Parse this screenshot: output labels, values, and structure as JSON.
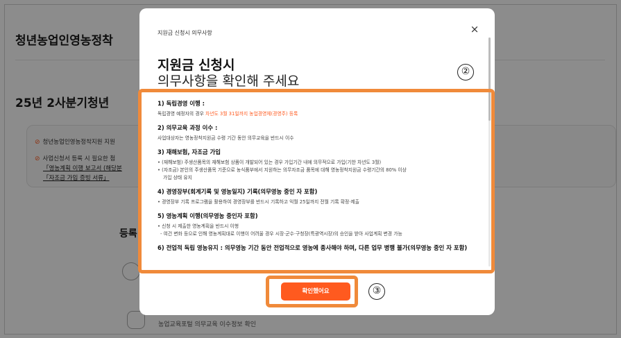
{
  "background": {
    "title": "청년농업인영농정착",
    "subtitle": "25년 2사분기청년",
    "notice_lines": [
      "청년농업인영농정착지원 지원",
      "사업신청서 등록 시 필요한 첨",
      "「영농계획 이행 보고서 (해당분",
      "「자조금 가입 증빙 서류」"
    ],
    "register_title": "등록",
    "row_text": "농업교육포털 의무교육 이수정보 확인"
  },
  "modal": {
    "header_title": "지원금 신청시 의무사항",
    "close_label": "×",
    "headline_line1": "지원금 신청시",
    "headline_line2": "의무사항을 확인해 주세요",
    "sections": [
      {
        "title": "1) 독립경영 이행 :",
        "body_prefix": "독립경영 예정자의 경우 ",
        "body_highlight": "차년도 3월 31일까지 농업경영체(경영주) 등록"
      },
      {
        "title": "2) 의무교육 과정 이수 :",
        "body": "사업대상자는 영농정착지원금 수령 기간 동안 의무교육을 반드시 이수"
      },
      {
        "title": "3) 재해보험, 자조금 가입",
        "bullets": [
          "• (재해보험) 주생산품목의 재해보험 상품이 개발되어 있는 경우 가입기간 내에 의무적으로 가입(기한 차년도 3월)",
          "• (자조금) 본인의 주생산품목 기준으로 농식품부에서 지원하는 의무자조금 품목에 대해 영농정착지원금 수령기간의 80% 이상",
          "가입 상태 유지"
        ]
      },
      {
        "title": "4) 경영장부(회계기록 및 영농일지) 기록(의무영농 중인 자 포함)",
        "bullets": [
          "• 경영장부 기록 프로그램을 활용하여 경영장부를 반드시 기록하고 익월 25일까지 전월 기록 확정·제출"
        ]
      },
      {
        "title": "5) 영농계획 이행(의무영농 중인자 포함)",
        "bullets": [
          "• 신청 시 제출한 영농계획을 반드시 이행",
          "- 여건 변화 등으로 인해 영농계획대로 이행이 어려울 경우 시장·군수·구청장(특광역시장)의 승인을 받아 사업계획 변경 가능"
        ]
      },
      {
        "title": "6) 전업적 독립 영농유지 : 의무영농 기간 동안 전업적으로 영농에 종사해야 하며, 다른 업무 병행 불가(의무영농 중인 자 포함)"
      }
    ],
    "confirm_label": "확인했어요"
  },
  "annotations": {
    "num_2": "②",
    "num_3": "③",
    "color": "#f08a3a"
  },
  "colors": {
    "accent": "#ff5a1f",
    "annotation": "#f08a3a"
  }
}
